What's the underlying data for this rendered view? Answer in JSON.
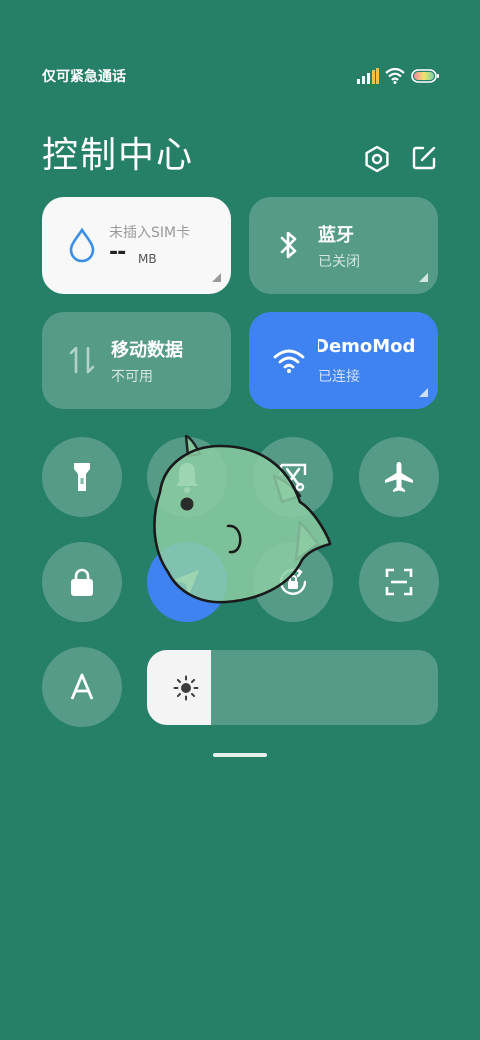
{
  "status_bar": {
    "carrier_text": "仅可紧急通话",
    "icons": [
      "signal-icon",
      "wifi-icon",
      "battery-icon"
    ]
  },
  "header": {
    "title": "控制中心",
    "icons": [
      "settings-icon",
      "edit-icon"
    ]
  },
  "tiles": {
    "data_usage": {
      "line1": "未插入SIM卡",
      "value": "--",
      "unit": "MB"
    },
    "bluetooth": {
      "title": "蓝牙",
      "status": "已关闭"
    },
    "mobile_data": {
      "title": "移动数据",
      "status": "不可用"
    },
    "wifi": {
      "title": "DemoMod",
      "status": "已连接"
    }
  },
  "toggles": [
    {
      "name": "flashlight",
      "icon": "flashlight-icon",
      "active": false
    },
    {
      "name": "silent",
      "icon": "bell-icon",
      "active": false
    },
    {
      "name": "screenshot",
      "icon": "scissors-icon",
      "active": false
    },
    {
      "name": "airplane-mode",
      "icon": "airplane-icon",
      "active": false
    },
    {
      "name": "lock-screen",
      "icon": "lock-icon",
      "active": false
    },
    {
      "name": "location",
      "icon": "location-arrow-icon",
      "active": true
    },
    {
      "name": "rotation-lock",
      "icon": "rotation-lock-icon",
      "active": false
    },
    {
      "name": "scanner",
      "icon": "scan-icon",
      "active": false
    },
    {
      "name": "font-size",
      "icon": "letter-a-icon",
      "active": false
    }
  ],
  "brightness": {
    "level": 0.22,
    "icon": "sun-icon"
  },
  "colors": {
    "background": "#267f67",
    "accent_blue": "#3f83f3",
    "tile_translucent": "rgba(255,255,255,0.22)",
    "data_tile": "#f7f8f7",
    "drop_icon": "#3b8fe8"
  }
}
